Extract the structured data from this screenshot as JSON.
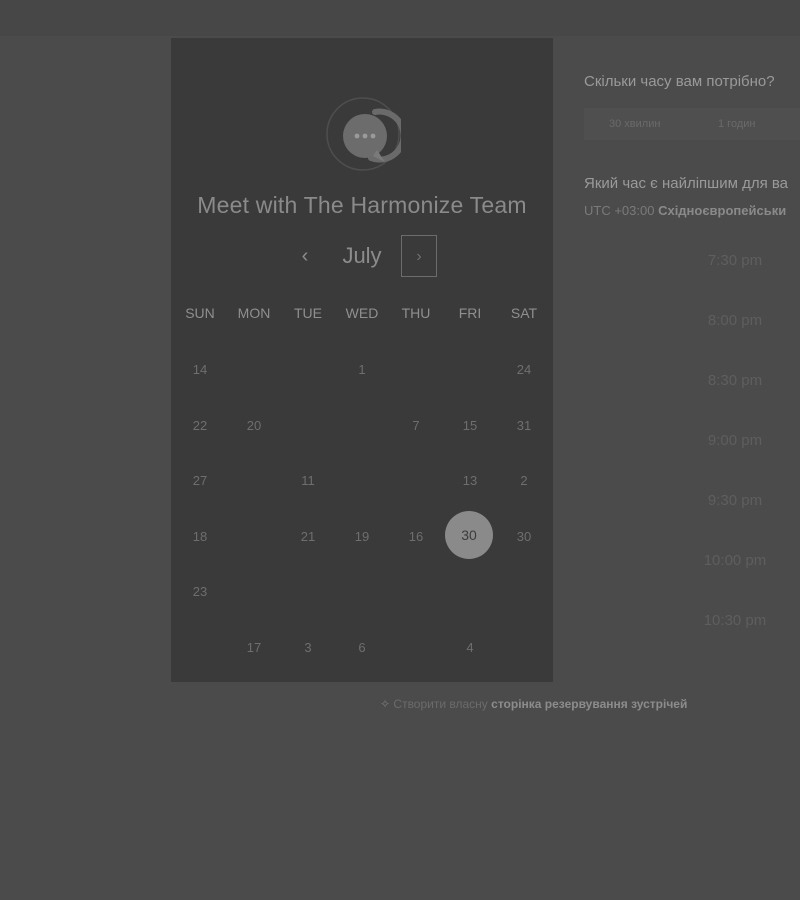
{
  "scheduler": {
    "title": "Meet with The Harmonize Team",
    "month": "July",
    "prev_label": "‹",
    "next_label": "›",
    "weekdays": [
      "SUN",
      "MON",
      "TUE",
      "WED",
      "THU",
      "FRI",
      "SAT"
    ],
    "days": {
      "r1": [
        "14",
        "1",
        "24"
      ],
      "r2": [
        "22",
        "20",
        "7",
        "15",
        "31"
      ],
      "r3": [
        "27",
        "11",
        "13",
        "2"
      ],
      "r4": [
        "18",
        "21",
        "19",
        "16",
        "30",
        "30"
      ],
      "r5": [
        "23"
      ],
      "r6": [
        "17",
        "3",
        "6",
        "4"
      ]
    },
    "selected_day": "30"
  },
  "duration": {
    "question": "Скільки часу вам потрібно?",
    "options": [
      "30 хвилин",
      "1 годин"
    ]
  },
  "time_pick": {
    "question": "Який час є найліпшим для ва",
    "timezone_prefix": "UTC +03:00",
    "timezone_name": "Східноєвропейськи",
    "slots": [
      "7:30 pm",
      "8:00 pm",
      "8:30 pm",
      "9:00 pm",
      "9:30 pm",
      "10:00 pm",
      "10:30 pm"
    ]
  },
  "footer": {
    "icon": "sparkle-icon",
    "text_prefix": "Створити власну",
    "text_link": "сторінка резервування зустрічей"
  }
}
